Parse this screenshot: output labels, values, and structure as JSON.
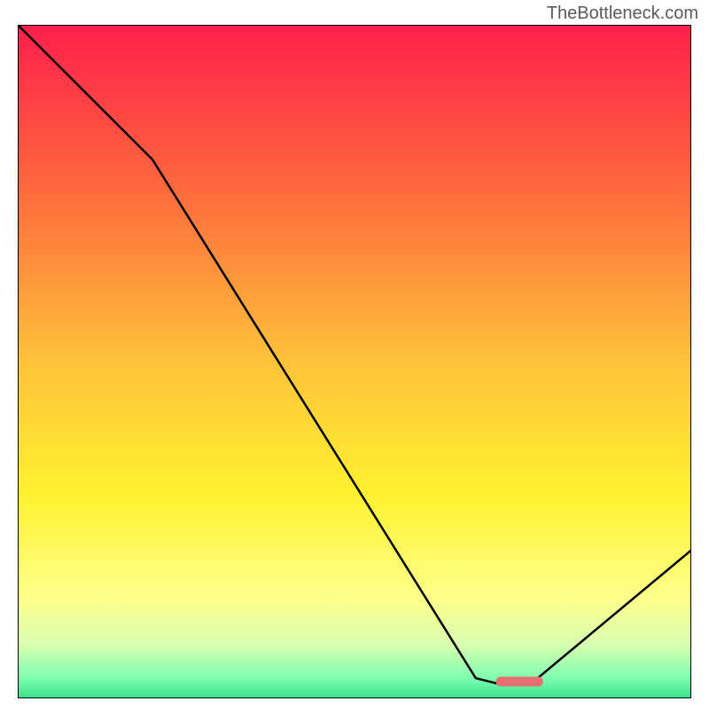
{
  "watermark": "TheBottleneck.com",
  "chart_data": {
    "type": "line",
    "title": "",
    "xlabel": "",
    "ylabel": "",
    "xlim": [
      0,
      100
    ],
    "ylim": [
      0,
      100
    ],
    "grid": false,
    "legend": false,
    "background_gradient": {
      "stops": [
        {
          "offset": 0,
          "color": "#ff1f4b"
        },
        {
          "offset": 25,
          "color": "#ff6b3d"
        },
        {
          "offset": 50,
          "color": "#ffc23a"
        },
        {
          "offset": 70,
          "color": "#fff22f"
        },
        {
          "offset": 85,
          "color": "#feff8a"
        },
        {
          "offset": 92,
          "color": "#d8ffb0"
        },
        {
          "offset": 97,
          "color": "#7fffb0"
        },
        {
          "offset": 100,
          "color": "#33e08a"
        }
      ]
    },
    "series": [
      {
        "name": "bottleneck-curve",
        "x": [
          0,
          20,
          68,
          72,
          76,
          100
        ],
        "values": [
          100,
          80,
          3,
          2,
          2,
          22
        ]
      }
    ],
    "marker": {
      "name": "optimal-zone",
      "x_start": 71,
      "x_end": 78,
      "y": 2.5,
      "color": "#e6706f"
    }
  }
}
